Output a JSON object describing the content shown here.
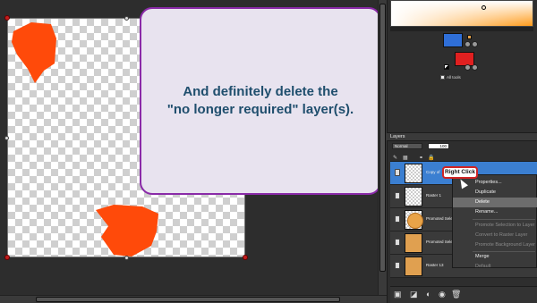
{
  "canvas": {
    "callout_text": "And definitely delete the\n\"no longer required\" layer(s)."
  },
  "colors": {
    "foreground": "#2f6fd8",
    "background": "#e02020",
    "picker_start": "#ffffff",
    "picker_end": "#ff9b1a",
    "callout_border": "#8a2aa8",
    "callout_text": "#1f4e6d",
    "selection": "#3b7fd1",
    "shape": "#ff4a0a"
  },
  "materials": {
    "all_tools_label": "All tools"
  },
  "layers_panel": {
    "title": "Layers",
    "blend_mode": "Normal",
    "opacity": "100",
    "layers": [
      {
        "name": "Copy of",
        "selected": true
      },
      {
        "name": "Raster 1",
        "selected": false
      },
      {
        "name": "Promoted Selection",
        "selected": false
      },
      {
        "name": "Promoted Selection 2",
        "selected": false
      },
      {
        "name": "Raster 13",
        "selected": false
      }
    ]
  },
  "tooltip": {
    "text": "Right Click"
  },
  "context_menu": {
    "items": [
      {
        "label": "Properties...",
        "enabled": true
      },
      {
        "label": "Duplicate",
        "enabled": true
      },
      {
        "label": "Delete",
        "enabled": true,
        "highlighted": true
      },
      {
        "label": "Rename...",
        "enabled": true
      },
      {
        "label": "Promote Selection to Layer",
        "enabled": false
      },
      {
        "label": "Convert to Raster Layer",
        "enabled": false
      },
      {
        "label": "Promote Background Layer",
        "enabled": false
      },
      {
        "label": "Merge",
        "enabled": true
      },
      {
        "label": "Default",
        "enabled": false
      }
    ]
  }
}
